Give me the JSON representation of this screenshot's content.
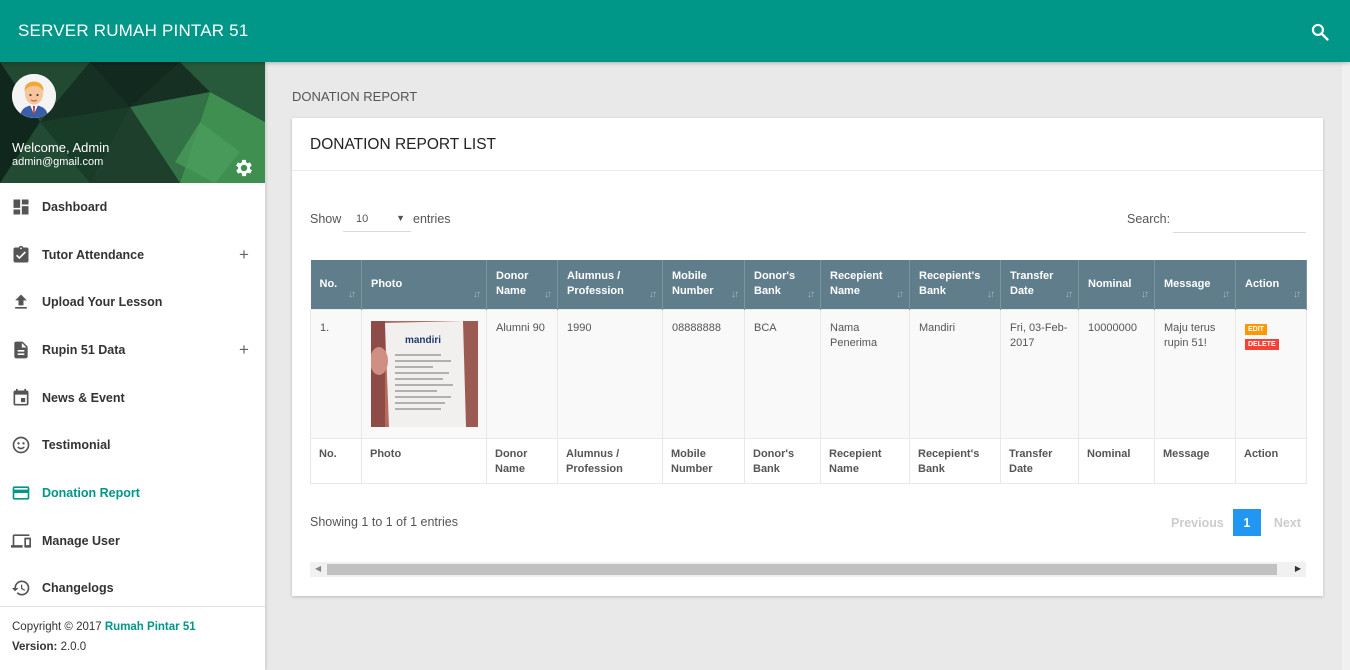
{
  "app": {
    "title": "SERVER RUMAH PINTAR 51"
  },
  "user": {
    "welcome": "Welcome, Admin",
    "email": "admin@gmail.com"
  },
  "menu": [
    {
      "label": "Dashboard",
      "icon": "dashboard-icon",
      "expandable": false
    },
    {
      "label": "Tutor Attendance",
      "icon": "assignment-check-icon",
      "expandable": true
    },
    {
      "label": "Upload Your Lesson",
      "icon": "upload-icon",
      "expandable": false
    },
    {
      "label": "Rupin 51 Data",
      "icon": "document-icon",
      "expandable": true
    },
    {
      "label": "News & Event",
      "icon": "calendar-icon",
      "expandable": false
    },
    {
      "label": "Testimonial",
      "icon": "smiley-icon",
      "expandable": false
    },
    {
      "label": "Donation Report",
      "icon": "credit-card-icon",
      "expandable": false,
      "active": true
    },
    {
      "label": "Manage User",
      "icon": "devices-icon",
      "expandable": false
    },
    {
      "label": "Changelogs",
      "icon": "history-icon",
      "expandable": false
    }
  ],
  "footer": {
    "copyright": "Copyright © 2017 ",
    "brand": "Rumah Pintar 51",
    "version_label": "Version:",
    "version": " 2.0.0"
  },
  "page": {
    "breadcrumb": "DONATION REPORT",
    "card_title": "DONATION REPORT LIST",
    "show_label": "Show",
    "length_value": "10",
    "entries_label": "entries",
    "search_label": "Search:",
    "search_value": ""
  },
  "table": {
    "columns": [
      "No.",
      "Photo",
      "Donor Name",
      "Alumnus / Profession",
      "Mobile Number",
      "Donor's Bank",
      "Recepient Name",
      "Recepient's Bank",
      "Transfer Date",
      "Nominal",
      "Message",
      "Action"
    ],
    "rows": [
      {
        "no": "1.",
        "donor_name": "Alumni 90",
        "alumnus": "1990",
        "mobile": "08888888",
        "donor_bank": "BCA",
        "recipient_name": "Nama Penerima",
        "recipient_bank": "Mandiri",
        "transfer_date": "Fri, 03-Feb-2017",
        "nominal": "10000000",
        "message": "Maju terus rupin 51!",
        "edit_label": "EDIT",
        "delete_label": "DELETE",
        "photo_text": "mandiri"
      }
    ]
  },
  "pagination": {
    "info": "Showing 1 to 1 of 1 entries",
    "previous": "Previous",
    "current": "1",
    "next": "Next"
  },
  "colors": {
    "primary": "#009688",
    "table_header": "#607d8b",
    "page_active": "#2196f3",
    "edit": "#ff9800",
    "delete": "#f44336"
  }
}
